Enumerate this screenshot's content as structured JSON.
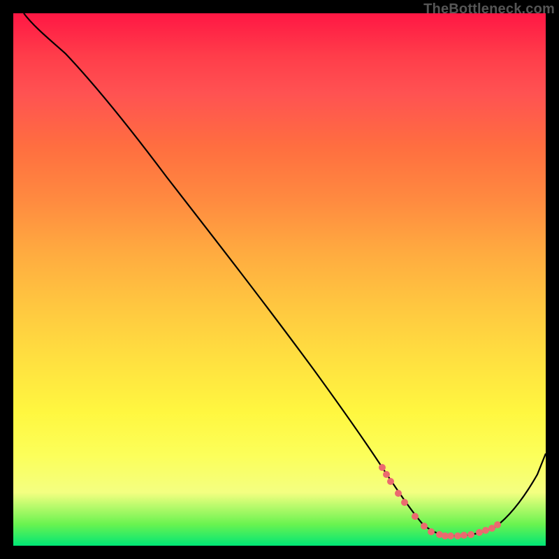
{
  "attribution": "TheBottleneck.com",
  "colors": {
    "background": "#000000",
    "curve": "#000000",
    "marker": "#eb6a6f",
    "gradient_top": "#ff1744",
    "gradient_bottom": "#00e676"
  },
  "chart_data": {
    "type": "line",
    "title": "",
    "xlabel": "",
    "ylabel": "",
    "xlim": [
      0,
      100
    ],
    "ylim": [
      0,
      100
    ],
    "series": [
      {
        "name": "bottleneck-curve",
        "x": [
          2,
          5,
          9,
          13,
          18,
          24,
          30,
          36,
          42,
          48,
          54,
          58,
          62,
          66,
          69,
          72,
          75,
          78,
          81,
          84,
          87,
          90,
          93,
          96,
          100
        ],
        "values": [
          100,
          98,
          95,
          92,
          87,
          81,
          73,
          65,
          57,
          49,
          41,
          35,
          29,
          22,
          16,
          11,
          7,
          4,
          2,
          2,
          2,
          3,
          6,
          12,
          22
        ]
      }
    ],
    "markers": {
      "name": "highlighted-region",
      "x": [
        69,
        71,
        73,
        75,
        77,
        79,
        81,
        83,
        85,
        87,
        89,
        91
      ],
      "values": [
        16,
        12,
        9,
        7,
        5,
        4,
        3,
        2,
        2,
        2,
        3,
        4
      ]
    }
  }
}
